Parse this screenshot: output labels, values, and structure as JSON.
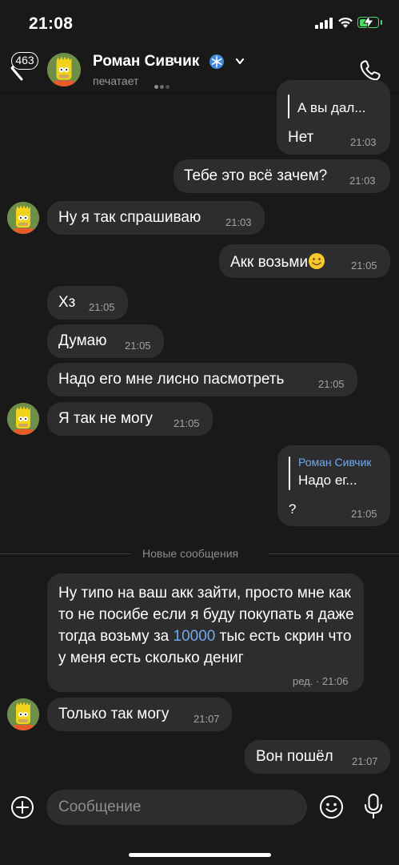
{
  "status_bar": {
    "time": "21:08"
  },
  "header": {
    "back_badge": "463",
    "contact_name": "Роман Сивчик",
    "status_text": "печатает"
  },
  "messages": [
    {
      "side": "out",
      "reply_text": "А вы дал...",
      "text": "Нет",
      "time": "21:03"
    },
    {
      "side": "out",
      "text": "Тебе это всё зачем?",
      "time": "21:03"
    },
    {
      "side": "in",
      "text": "Ну я так спрашиваю",
      "time": "21:03"
    },
    {
      "side": "out",
      "text": "Акк возьми",
      "emoji": "slightly-smiling-face",
      "time": "21:05"
    },
    {
      "side": "in",
      "text": "Хз",
      "time": "21:05"
    },
    {
      "side": "in",
      "text": "Думаю",
      "time": "21:05"
    },
    {
      "side": "in",
      "text": "Надо его мне лисно пасмотреть",
      "time": "21:05"
    },
    {
      "side": "in",
      "text": "Я так не могу",
      "time": "21:05"
    },
    {
      "side": "out",
      "reply_name": "Роман Сивчик",
      "reply_text": "Надо ег...",
      "text": "?",
      "time": "21:05"
    },
    {
      "side": "in",
      "text_before_link": "Ну типо на ваш акк зайти, просто мне как то не посибе если я буду покупать я даже тогда возьму за ",
      "link": "10000",
      "text_after_link": " тыс есть скрин что у меня есть сколько дениг",
      "time": "ред. · 21:06"
    },
    {
      "side": "in",
      "text": "Только так могу",
      "time": "21:07"
    },
    {
      "side": "out",
      "text": "Вон пошёл",
      "time": "21:07"
    }
  ],
  "divider": {
    "label": "Новые сообщения"
  },
  "composer": {
    "placeholder": "Сообщение"
  },
  "colors": {
    "background": "#19191a",
    "bubble": "#2d2d2f",
    "link": "#71aaeb",
    "battery": "#4cd964"
  }
}
